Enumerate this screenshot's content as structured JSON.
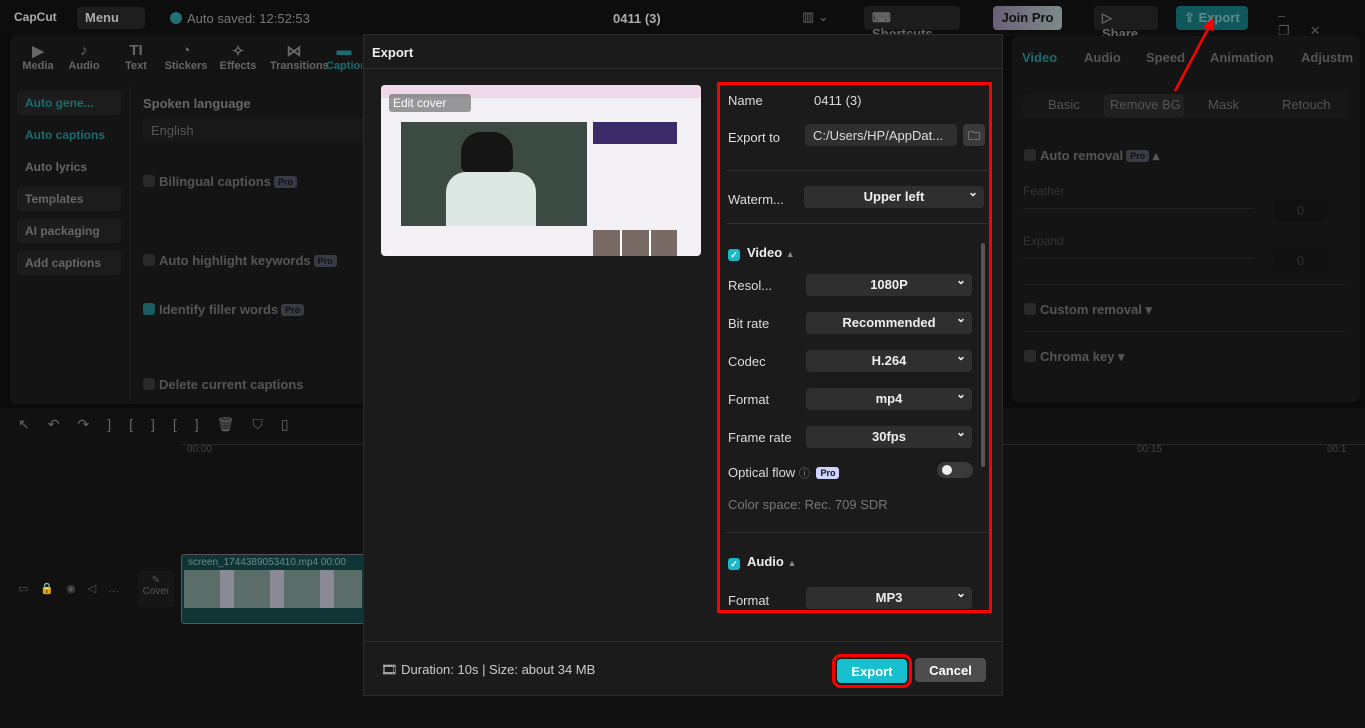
{
  "topbar": {
    "logo": "CapCut",
    "menu": "Menu",
    "autosaved": "Auto saved: 12:52:53",
    "project": "0411 (3)",
    "shortcuts": "Shortcuts",
    "join_pro": "Join Pro",
    "share": "Share",
    "export": "Export"
  },
  "tools": [
    {
      "icon": "media-icon",
      "label": "Media",
      "glyph": "▶"
    },
    {
      "icon": "audio-icon",
      "label": "Audio",
      "glyph": "♪"
    },
    {
      "icon": "text-icon",
      "label": "Text",
      "glyph": "TI"
    },
    {
      "icon": "stickers-icon",
      "label": "Stickers",
      "glyph": "◔"
    },
    {
      "icon": "effects-icon",
      "label": "Effects",
      "glyph": "✧"
    },
    {
      "icon": "transitions-icon",
      "label": "Transitions",
      "glyph": "⋈"
    },
    {
      "icon": "captions-icon",
      "label": "Captions",
      "glyph": "▬"
    }
  ],
  "sidebar": [
    "Auto gene...",
    "Auto captions",
    "Auto lyrics",
    "Templates",
    "AI packaging",
    "Add captions"
  ],
  "captions": {
    "spoken_language": "Spoken language",
    "language": "English",
    "bilingual": "Bilingual captions",
    "highlight": "Auto highlight keywords",
    "filler": "Identify filler words",
    "delete": "Delete current captions",
    "pro": "Pro"
  },
  "right_panel": {
    "tabs": [
      "Video",
      "Audio",
      "Speed",
      "Animation",
      "Adjustm"
    ],
    "subtabs": [
      "Basic",
      "Remove BG",
      "Mask",
      "Retouch"
    ],
    "auto_removal": "Auto removal",
    "feather": "Feather",
    "expand": "Expand",
    "feather_val": "0",
    "expand_val": "0",
    "custom_removal": "Custom removal",
    "chroma_key": "Chroma key"
  },
  "timeline": {
    "t0": "00:00",
    "t15": "00:15",
    "t30": "00:1",
    "clip_name": "screen_1744389053410.mp4",
    "clip_time": "00:00",
    "cover": "Cover"
  },
  "export_dialog": {
    "title": "Export",
    "cover_label": "Edit cover",
    "name_label": "Name",
    "name_value": "0411 (3)",
    "export_to_label": "Export to",
    "export_to_value": "C:/Users/HP/AppDat...",
    "watermark_label": "Waterm...",
    "watermark_value": "Upper left",
    "video_label": "Video",
    "resolution_label": "Resol...",
    "resolution_value": "1080P",
    "bitrate_label": "Bit rate",
    "bitrate_value": "Recommended",
    "codec_label": "Codec",
    "codec_value": "H.264",
    "format_label": "Format",
    "format_value": "mp4",
    "framerate_label": "Frame rate",
    "framerate_value": "30fps",
    "optical_flow_label": "Optical flow",
    "pro": "Pro",
    "color_space": "Color space: Rec. 709 SDR",
    "audio_label": "Audio",
    "audio_format_label": "Format",
    "audio_format_value": "MP3",
    "footer_info": "Duration: 10s | Size: about 34 MB",
    "export_button": "Export",
    "cancel_button": "Cancel"
  },
  "colors": {
    "accent": "#17bfcf",
    "highlight": "#ff0000"
  }
}
